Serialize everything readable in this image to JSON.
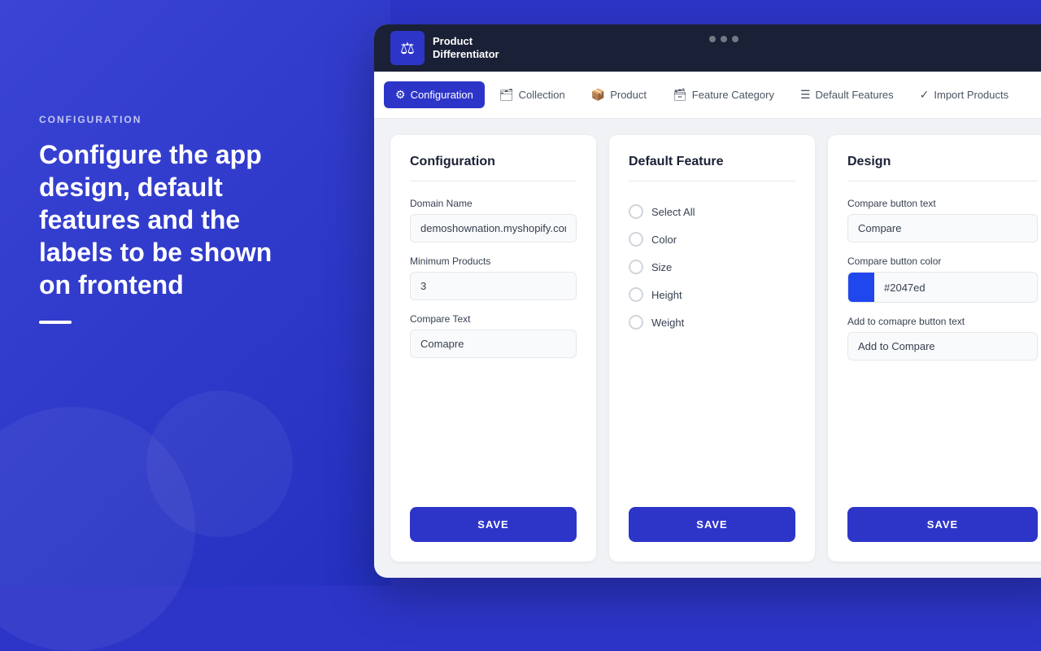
{
  "background": {
    "section_label": "CONFIGURATION",
    "headline": "Configure the app design, default features and the labels to be shown on frontend"
  },
  "app": {
    "logo": {
      "icon": "⚖",
      "text_line1": "Product",
      "text_line2": "Differentiator"
    },
    "nav": {
      "tabs": [
        {
          "id": "configuration",
          "label": "Configuration",
          "icon": "⚙",
          "active": true
        },
        {
          "id": "collection",
          "label": "Collection",
          "icon": "🗂",
          "active": false
        },
        {
          "id": "product",
          "label": "Product",
          "icon": "📦",
          "active": false
        },
        {
          "id": "feature-category",
          "label": "Feature Category",
          "icon": "🗃",
          "active": false
        },
        {
          "id": "default-features",
          "label": "Default Features",
          "icon": "☰",
          "active": false
        },
        {
          "id": "import-products",
          "label": "Import Products",
          "icon": "✓",
          "active": false
        }
      ]
    },
    "configuration_card": {
      "title": "Configuration",
      "fields": [
        {
          "label": "Domain Name",
          "value": "demoshownation.myshopify.com",
          "placeholder": "demoshownation.myshopify.com"
        },
        {
          "label": "Minimum Products",
          "value": "3",
          "placeholder": "3"
        },
        {
          "label": "Compare Text",
          "value": "Comapre",
          "placeholder": "Comapre"
        }
      ],
      "save_label": "SAVE"
    },
    "default_feature_card": {
      "title": "Default Feature",
      "items": [
        {
          "label": "Select All",
          "checked": false
        },
        {
          "label": "Color",
          "checked": false
        },
        {
          "label": "Size",
          "checked": false
        },
        {
          "label": "Height",
          "checked": false
        },
        {
          "label": "Weight",
          "checked": false
        }
      ],
      "save_label": "SAVE"
    },
    "design_card": {
      "title": "Design",
      "compare_button_text_label": "Compare button text",
      "compare_button_text_value": "Compare",
      "compare_button_color_label": "Compare button color",
      "compare_button_color_hex": "#2047ed",
      "add_to_compare_label": "Add to comapre button text",
      "add_to_compare_value": "Add to Compare",
      "save_label": "SAVE"
    }
  }
}
